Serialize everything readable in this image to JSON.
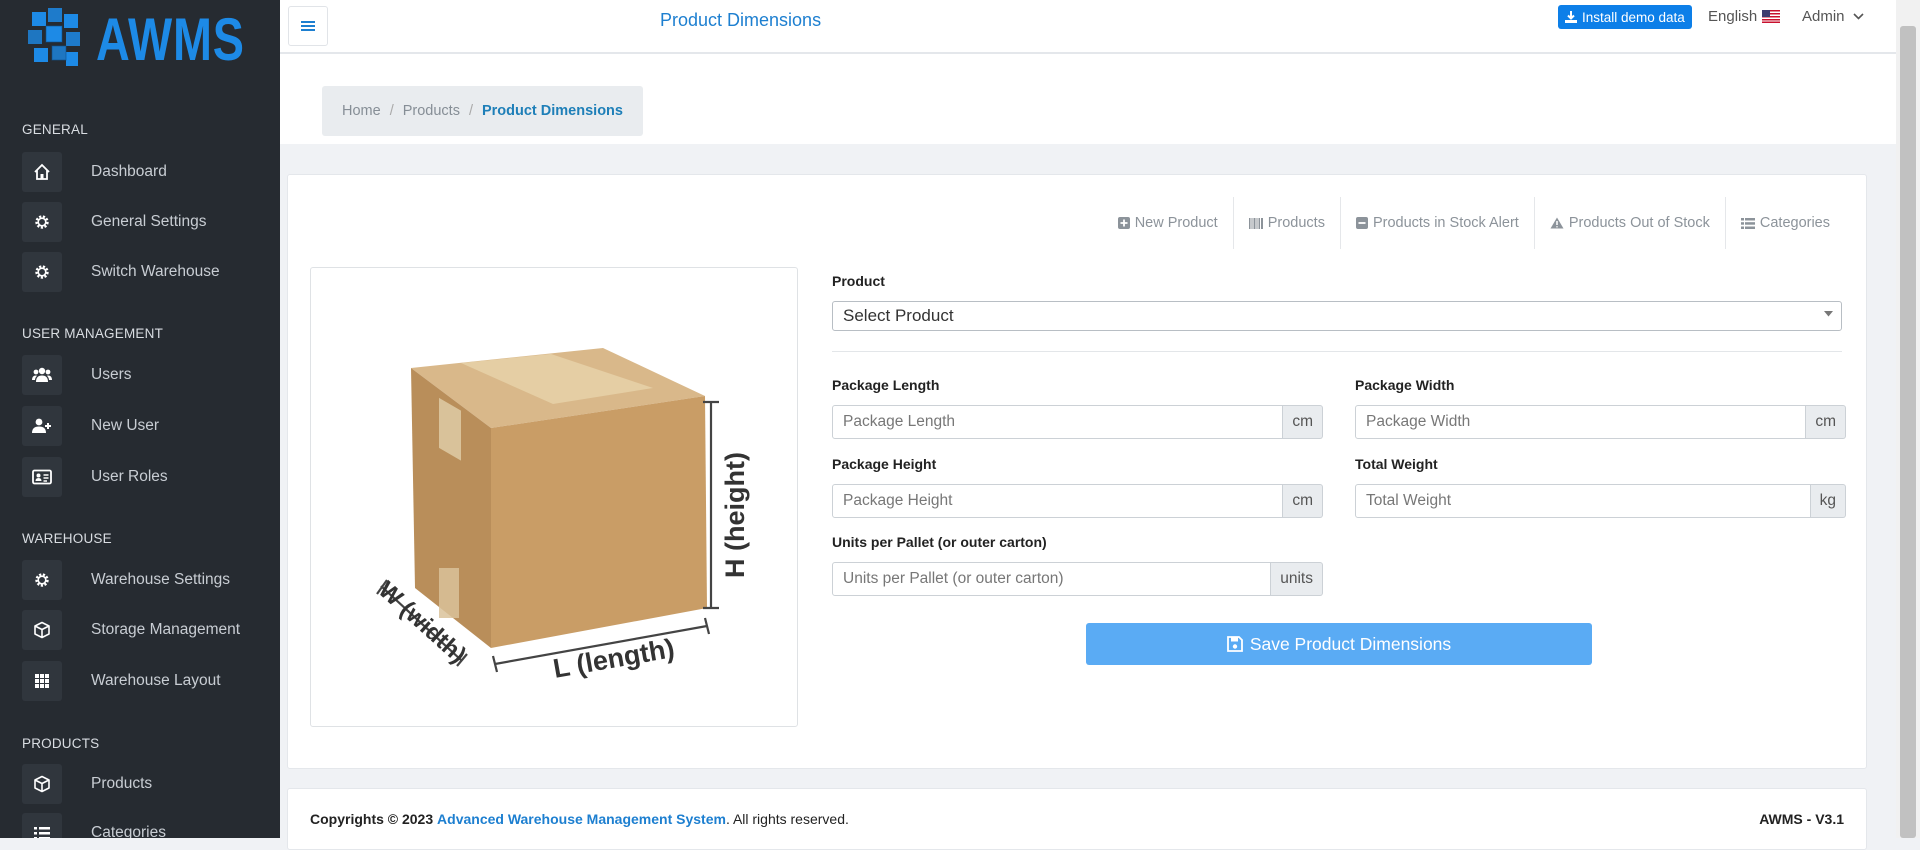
{
  "app": {
    "logo_text": "AWMS"
  },
  "header": {
    "title": "Product Dimensions",
    "install_label": "Install demo data",
    "language": "English",
    "user": "Admin"
  },
  "breadcrumb": {
    "home": "Home",
    "products": "Products",
    "current": "Product Dimensions"
  },
  "sidebar": {
    "sections": [
      {
        "title": "GENERAL",
        "items": [
          {
            "label": "Dashboard",
            "icon": "home-icon"
          },
          {
            "label": "General Settings",
            "icon": "gear-icon"
          },
          {
            "label": "Switch Warehouse",
            "icon": "gear-icon"
          }
        ]
      },
      {
        "title": "USER MANAGEMENT",
        "items": [
          {
            "label": "Users",
            "icon": "users-icon"
          },
          {
            "label": "New User",
            "icon": "user-plus-icon"
          },
          {
            "label": "User Roles",
            "icon": "id-card-icon"
          }
        ]
      },
      {
        "title": "WAREHOUSE",
        "items": [
          {
            "label": "Warehouse Settings",
            "icon": "gear-icon"
          },
          {
            "label": "Storage Management",
            "icon": "cube-icon"
          },
          {
            "label": "Warehouse Layout",
            "icon": "grid-icon"
          }
        ]
      },
      {
        "title": "PRODUCTS",
        "items": [
          {
            "label": "Products",
            "icon": "cube-icon"
          },
          {
            "label": "Categories",
            "icon": "list-icon"
          }
        ]
      }
    ]
  },
  "quick_links": {
    "new_product": "New Product",
    "products": "Products",
    "stock_alert": "Products in Stock Alert",
    "out_of_stock": "Products Out of Stock",
    "categories": "Categories"
  },
  "image": {
    "height_label": "H (height)",
    "width_label": "W (width)",
    "length_label": "L (length)"
  },
  "form": {
    "product_label": "Product",
    "product_selected": "Select Product",
    "length_label": "Package Length",
    "length_placeholder": "Package Length",
    "length_unit": "cm",
    "width_label": "Package Width",
    "width_placeholder": "Package Width",
    "width_unit": "cm",
    "height_label": "Package Height",
    "height_placeholder": "Package Height",
    "height_unit": "cm",
    "weight_label": "Total Weight",
    "weight_placeholder": "Total Weight",
    "weight_unit": "kg",
    "units_label": "Units per Pallet (or outer carton)",
    "units_placeholder": "Units per Pallet (or outer carton)",
    "units_unit": "units",
    "save_label": "Save Product Dimensions"
  },
  "footer": {
    "copyright_prefix": "Copyrights © 2023",
    "company_link": "Advanced Warehouse Management System",
    "rights": ". All rights reserved.",
    "version": "AWMS - V3.1"
  },
  "colors": {
    "accent": "#1d7fd0",
    "sidebar_bg": "#262b31",
    "save_button": "#5aabf4",
    "install_button": "#0d7fe8"
  }
}
